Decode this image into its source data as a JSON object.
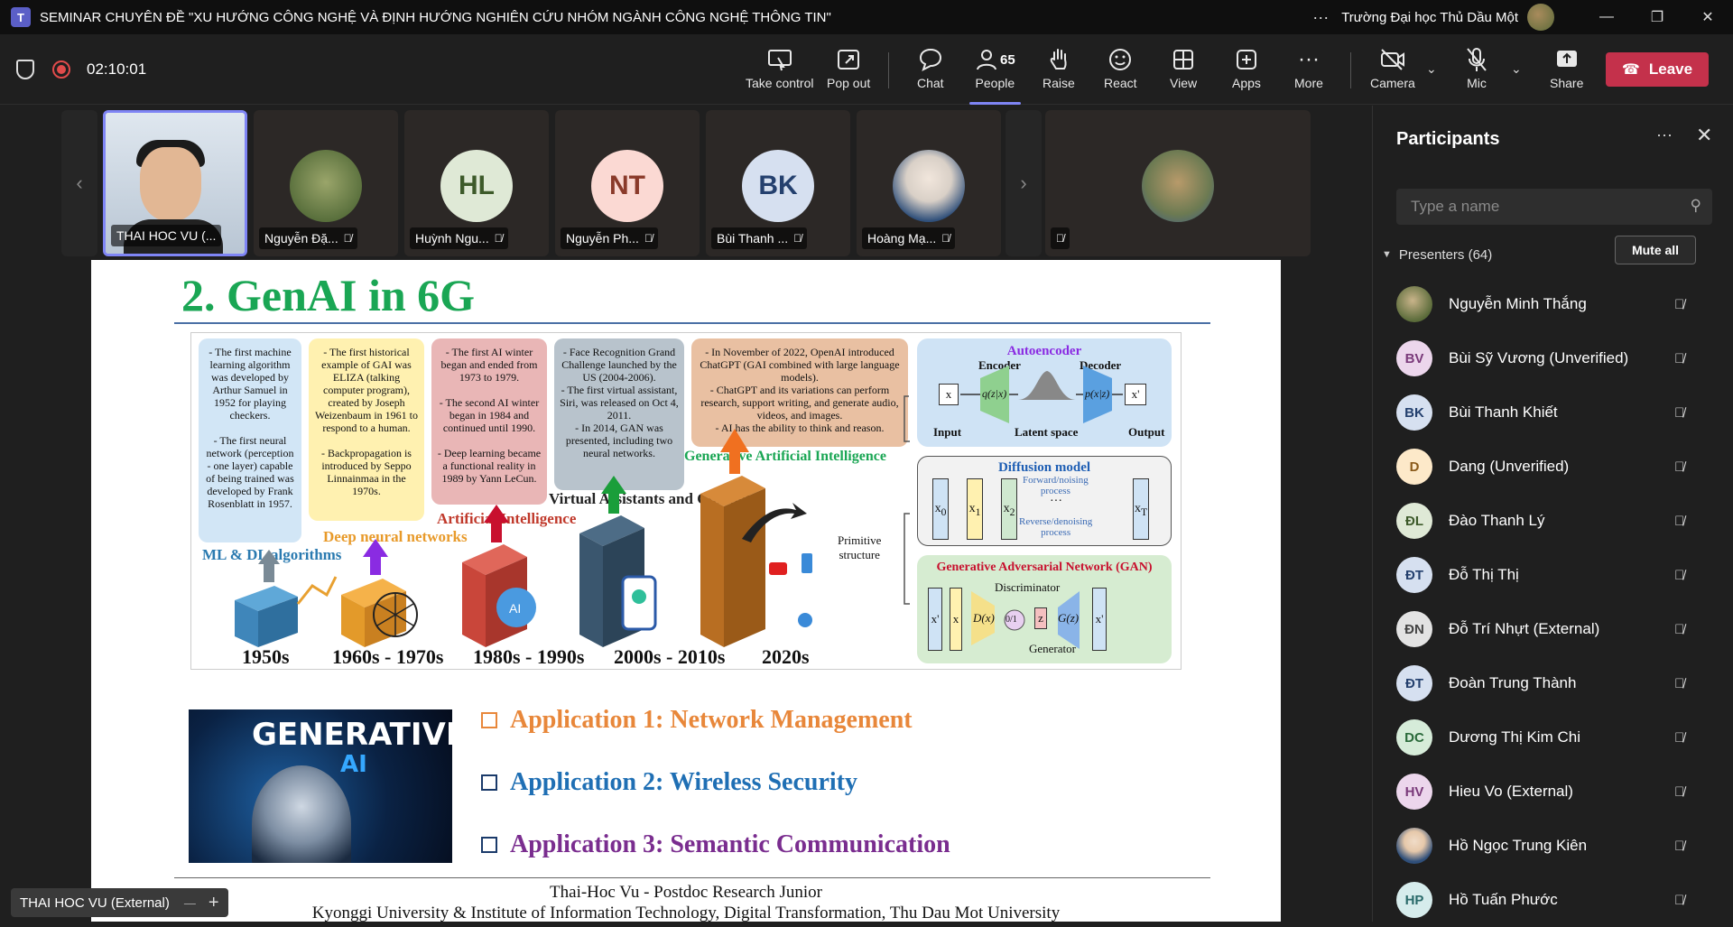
{
  "window": {
    "title": "SEMINAR CHUYÊN ĐỀ \"XU HƯỚNG CÔNG NGHỆ VÀ ĐỊNH HƯỚNG NGHIÊN CỨU NHÓM NGÀNH CÔNG NGHỆ THÔNG TIN\"",
    "organization": "Trường Đại học Thủ Dầu Một",
    "more_glyph": "···",
    "minimize_glyph": "—",
    "maximize_glyph": "❐",
    "close_glyph": "✕"
  },
  "toolbar": {
    "timer": "02:10:01",
    "take_control": "Take control",
    "pop_out": "Pop out",
    "chat": "Chat",
    "people": "People",
    "people_count": "65",
    "raise": "Raise",
    "react": "React",
    "view": "View",
    "apps": "Apps",
    "more": "More",
    "camera": "Camera",
    "mic": "Mic",
    "share": "Share",
    "leave": "Leave"
  },
  "video_strip": {
    "tiles": [
      {
        "name": "THAI HOC VU (...",
        "selected": true
      },
      {
        "name": "Nguyễn Đặ...",
        "initials": ""
      },
      {
        "name": "Huỳnh Ngu...",
        "initials": "HL",
        "color": "#dfe9d6",
        "text_color": "#3d5a2a"
      },
      {
        "name": "Nguyễn Ph...",
        "initials": "NT",
        "color": "#fbd9d3",
        "text_color": "#8a3a2a"
      },
      {
        "name": "Bùi Thanh ...",
        "initials": "BK",
        "color": "#d6e0f0",
        "text_color": "#24406e"
      },
      {
        "name": "Hoàng Mạ...",
        "initials": ""
      }
    ]
  },
  "slide": {
    "title": "2. GenAI in 6G",
    "boxes": {
      "b1": "- The first machine learning algorithm was developed by Arthur Samuel in 1952 for playing checkers.\n\n- The first neural network (perception - one layer) capable of being trained was developed by Frank Rosenblatt in 1957.",
      "b2": "- The first historical example of GAI was ELIZA (talking computer program), created by Joseph Weizenbaum in 1961 to respond to a human.\n\n- Backpropagation is introduced by Seppo Linnainmaa in the 1970s.",
      "b3": "- The first AI winter began and ended from 1973 to 1979.\n\n- The second AI winter began in 1984 and continued until 1990.\n\n- Deep learning became a functional reality in 1989 by Yann LeCun.",
      "b4": "- Face Recognition Grand Challenge launched by the US (2004-2006).\n- The first virtual assistant, Siri, was released on Oct 4, 2011.\n- In 2014, GAN was presented, including two neural networks.",
      "b5": "- In November of  2022, OpenAI introduced ChatGPT (GAI combined with large language models).\n- ChatGPT and its variations can perform research, support writing, and generate audio, videos, and images.\n- AI has the ability to think and reason."
    },
    "era_labels": {
      "ml": "ML & DL algorithms",
      "dnn": "Deep neural networks",
      "ai": "Artificial Intelligence",
      "va": "Virtual Assistants and Chatbots",
      "gai": "Generative Artificial Intelligence"
    },
    "years": [
      "1950s",
      "1960s - 1970s",
      "1980s - 1990s",
      "2000s - 2010s",
      "2020s"
    ],
    "primitive": "Primitive\nstructure",
    "autoencoder": {
      "title": "Autoencoder",
      "encoder": "Encoder",
      "decoder": "Decoder",
      "x": "x",
      "xp": "x'",
      "qzx": "q(z|x)",
      "pxz": "p(x|z)",
      "input": "Input",
      "latent": "Latent space",
      "output": "Output"
    },
    "diffusion": {
      "title": "Diffusion model",
      "forward": "Forward/noising\nprocess",
      "reverse": "Reverse/denoising\nprocess",
      "x0": "x",
      "x0_sub": "0",
      "x1": "x",
      "x1_sub": "1",
      "x2": "x",
      "x2_sub": "2",
      "dots": "···",
      "xt": "x",
      "xt_sub": "T"
    },
    "gan": {
      "title": "Generative Adversarial Network (GAN)",
      "discriminator": "Discriminator",
      "generator": "Generator",
      "xp": "x'",
      "x": "x",
      "dx": "D(x)",
      "out": "0/1",
      "z": "z",
      "gz": "G(z)"
    },
    "image_text_1": "GENERATIVE",
    "image_text_2": "AI",
    "applications": [
      {
        "label": "Application 1: Network Management",
        "color": "#e8873a"
      },
      {
        "label": "Application 2: Wireless Security",
        "color": "#1f6fb4"
      },
      {
        "label": "Application 3: Semantic Communication",
        "color": "#7a2d8f"
      }
    ],
    "footer_line1": "Thai-Hoc Vu - Postdoc Research Junior",
    "footer_line2": "Kyonggi University & Institute of Information Technology, Digital Transformation, Thu Dau Mot University"
  },
  "presenter_tag": "THAI HOC VU (External)",
  "panel": {
    "title": "Participants",
    "search_placeholder": "Type a name",
    "presenters_label": "Presenters (64)",
    "mute_all": "Mute all",
    "participants": [
      {
        "name": "Nguyễn Minh Thắng",
        "initials": "",
        "color": "#7a8c5a",
        "text_color": "#fff"
      },
      {
        "name": "Bùi Sỹ Vương (Unverified)",
        "initials": "BV",
        "color": "#ecd6ec",
        "text_color": "#7a3a7a"
      },
      {
        "name": "Bùi Thanh Khiết",
        "initials": "BK",
        "color": "#d6e0f0",
        "text_color": "#24406e"
      },
      {
        "name": "Dang (Unverified)",
        "initials": "D",
        "color": "#fde9c9",
        "text_color": "#8a5a1a"
      },
      {
        "name": "Đào Thanh Lý",
        "initials": "ĐL",
        "color": "#dfe9d6",
        "text_color": "#3d5a2a"
      },
      {
        "name": "Đỗ Thị Thị",
        "initials": "ĐT",
        "color": "#d6e0f0",
        "text_color": "#24406e"
      },
      {
        "name": "Đỗ Trí Nhựt (External)",
        "initials": "ĐN",
        "color": "#e3e3e3",
        "text_color": "#444"
      },
      {
        "name": "Đoàn Trung Thành",
        "initials": "ĐT",
        "color": "#d6e0f0",
        "text_color": "#24406e"
      },
      {
        "name": "Dương Thị Kim Chi",
        "initials": "DC",
        "color": "#d6ecd9",
        "text_color": "#2a6a3a"
      },
      {
        "name": "Hieu Vo (External)",
        "initials": "HV",
        "color": "#ecd6ec",
        "text_color": "#7a3a7a"
      },
      {
        "name": "Hồ Ngọc Trung Kiên",
        "initials": "",
        "color": "#c9d7ea",
        "text_color": "#24406e"
      },
      {
        "name": "Hồ Tuấn Phước",
        "initials": "HP",
        "color": "#d6ecec",
        "text_color": "#2a6a6a"
      }
    ]
  }
}
